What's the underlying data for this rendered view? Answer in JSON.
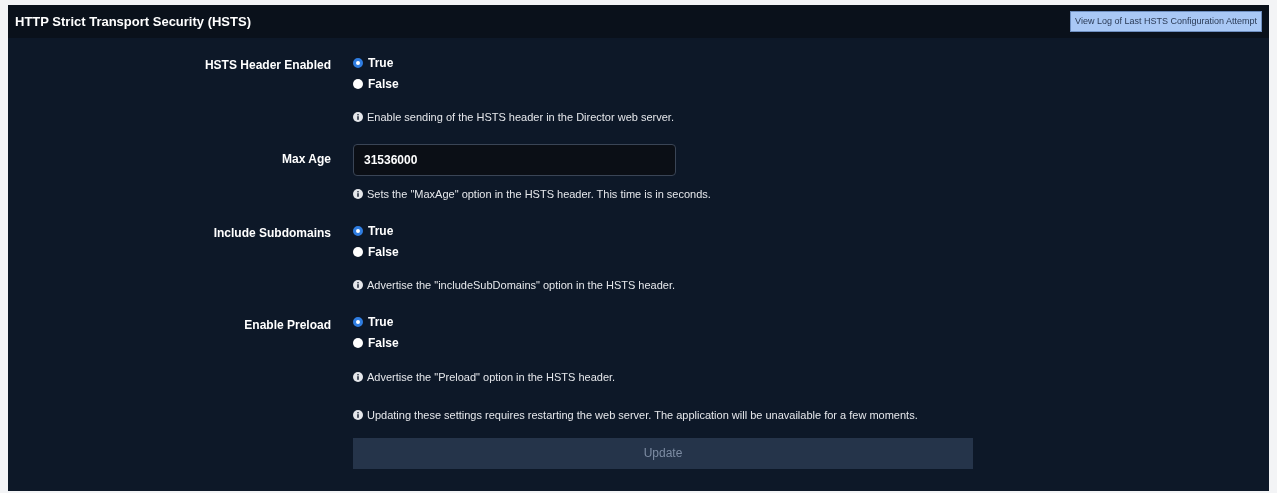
{
  "panel": {
    "title": "HTTP Strict Transport Security (HSTS)",
    "log_button": "View Log of Last HSTS Configuration Attempt"
  },
  "fields": [
    {
      "kind": "radio",
      "label": "HSTS Header Enabled",
      "options": [
        {
          "label": "True",
          "selected": true
        },
        {
          "label": "False",
          "selected": false
        }
      ],
      "help": "Enable sending of the HSTS header in the Director web server."
    },
    {
      "kind": "text",
      "label": "Max Age",
      "value": "31536000",
      "help": "Sets the \"MaxAge\" option in the HSTS header. This time is in seconds."
    },
    {
      "kind": "radio",
      "label": "Include Subdomains",
      "options": [
        {
          "label": "True",
          "selected": true
        },
        {
          "label": "False",
          "selected": false
        }
      ],
      "help": "Advertise the \"includeSubDomains\" option in the HSTS header."
    },
    {
      "kind": "radio",
      "label": "Enable Preload",
      "options": [
        {
          "label": "True",
          "selected": true
        },
        {
          "label": "False",
          "selected": false
        }
      ],
      "help": "Advertise the \"Preload\" option in the HSTS header."
    }
  ],
  "notice": "Updating these settings requires restarting the web server. The application will be unavailable for a few moments.",
  "update_button": {
    "label": "Update",
    "disabled": true
  }
}
